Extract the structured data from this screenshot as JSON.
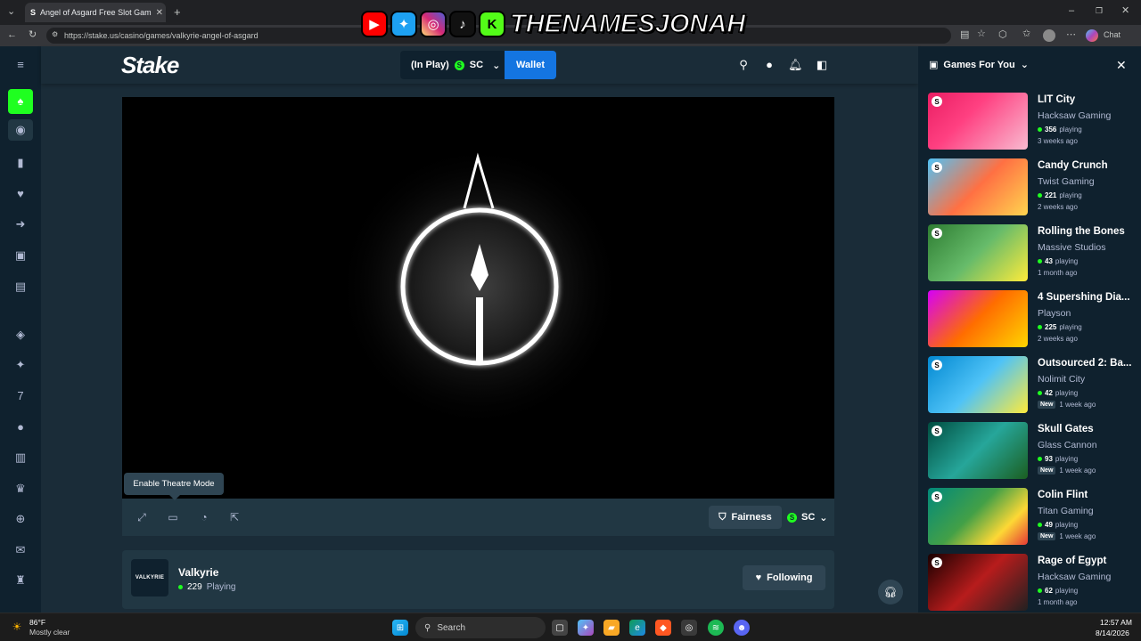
{
  "browser": {
    "tab_title": "Angel of Asgard Free Slot Gam",
    "url": "https://stake.us/casino/games/valkyrie-angel-of-asgard",
    "chat_label": "Chat"
  },
  "banner": {
    "name": "THENAMESJONAH",
    "k_letter": "K"
  },
  "header": {
    "logo": "Stake",
    "balance_status": "(In Play)",
    "currency": "SC",
    "coin_symbol": "S",
    "wallet_label": "Wallet"
  },
  "game_toolbar": {
    "tooltip": "Enable Theatre Mode",
    "fairness_label": "Fairness",
    "currency": "SC"
  },
  "provider": {
    "logo_text": "VALKYRIE",
    "name": "Valkyrie",
    "playing_count": "229",
    "playing_label": "Playing",
    "follow_label": "Following"
  },
  "right_panel": {
    "title": "Games For You",
    "games": [
      {
        "title": "LIT City",
        "provider": "Hacksaw Gaming",
        "playing": "356",
        "playing_suffix": "playing",
        "time": "3 weeks ago",
        "new": ""
      },
      {
        "title": "Candy Crunch",
        "provider": "Twist Gaming",
        "playing": "221",
        "playing_suffix": "playing",
        "time": "2 weeks ago",
        "new": ""
      },
      {
        "title": "Rolling the Bones",
        "provider": "Massive Studios",
        "playing": "43",
        "playing_suffix": "playing",
        "time": "1 month ago",
        "new": ""
      },
      {
        "title": "4 Supershing Dia...",
        "provider": "Playson",
        "playing": "225",
        "playing_suffix": "playing",
        "time": "2 weeks ago",
        "new": ""
      },
      {
        "title": "Outsourced 2: Ba...",
        "provider": "Nolimit City",
        "playing": "42",
        "playing_suffix": "playing",
        "time": "1 week ago",
        "new": "New"
      },
      {
        "title": "Skull Gates",
        "provider": "Glass Cannon",
        "playing": "93",
        "playing_suffix": "playing",
        "time": "1 week ago",
        "new": "New"
      },
      {
        "title": "Colin Flint",
        "provider": "Titan Gaming",
        "playing": "49",
        "playing_suffix": "playing",
        "time": "1 week ago",
        "new": "New"
      },
      {
        "title": "Rage of Egypt",
        "provider": "Hacksaw Gaming",
        "playing": "62",
        "playing_suffix": "playing",
        "time": "1 month ago",
        "new": ""
      }
    ]
  },
  "taskbar": {
    "weather_temp": "86°F",
    "weather_desc": "Mostly clear",
    "search_label": "Search",
    "time": "12:57 AM",
    "date": "8/14/2026"
  }
}
